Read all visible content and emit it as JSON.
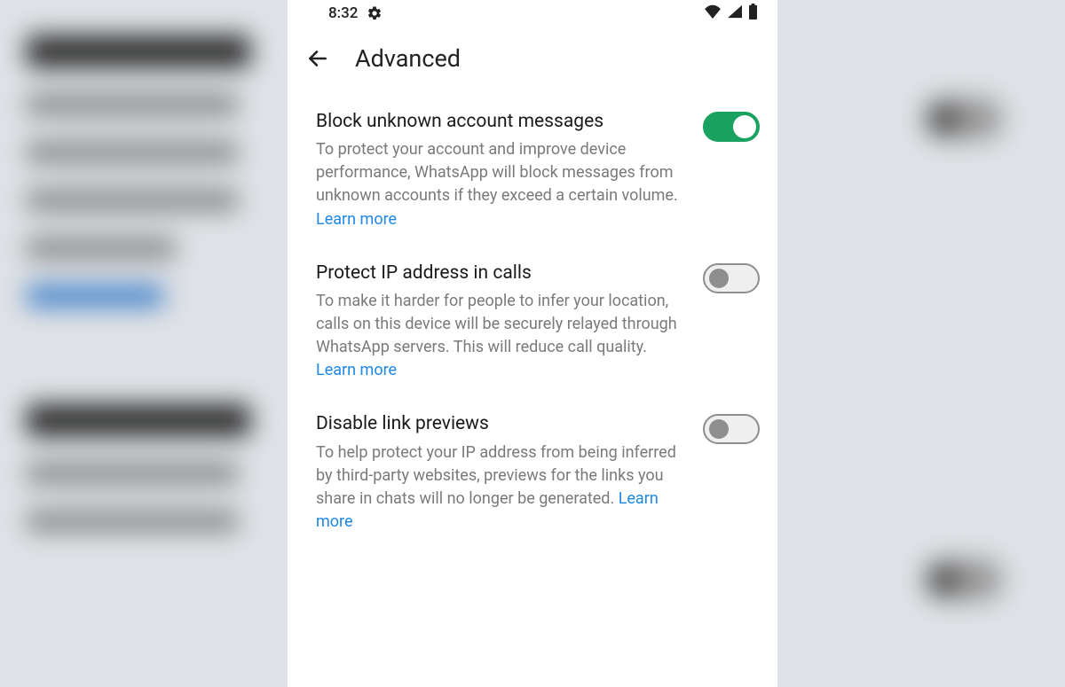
{
  "status": {
    "time": "8:32"
  },
  "appbar": {
    "title": "Advanced"
  },
  "settings": [
    {
      "title": "Block unknown account messages",
      "desc": "To protect your account and improve device performance, WhatsApp will block messages from unknown accounts if they exceed a certain volume.",
      "learn": "Learn more",
      "on": true
    },
    {
      "title": "Protect IP address in calls",
      "desc": "To make it harder for people to infer your location, calls on this device will be securely relayed through WhatsApp servers. This will reduce call quality.",
      "learn": "Learn more",
      "on": false
    },
    {
      "title": "Disable link previews",
      "desc": "To help protect your IP address from being inferred by third-party websites, previews for the links you share in chats will no longer be generated.",
      "learn": "Learn more",
      "on": false
    }
  ],
  "colors": {
    "accent_green": "#1aa260",
    "link_blue": "#1e88e5",
    "text_primary": "#1a1a1a",
    "text_secondary": "#7a7a7a"
  }
}
